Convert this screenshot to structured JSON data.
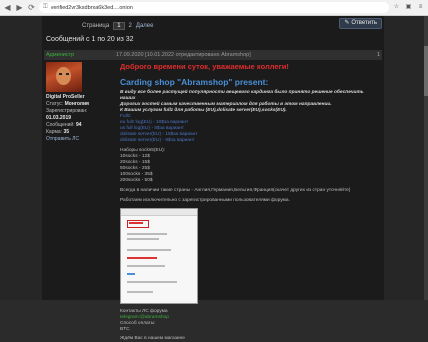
{
  "browser": {
    "url": "verified2vr3ksdbrxa6k3ed....onion",
    "lock_icon": "lock-icon"
  },
  "pager": {
    "label": "Страница",
    "current": "1",
    "next_page": "2",
    "next_label": "Далее"
  },
  "reply_label": "Ответить",
  "message_count": "Сообщений с 1 по 20 из 32",
  "post": {
    "author": "Администр",
    "date": "17.09.2020  [10.01.2022 отредактировано Abramshop]",
    "number": "1"
  },
  "user": {
    "name": "Digital ProSeller",
    "groups": [
      {
        "label": "Статус:",
        "value": "Монголия"
      },
      {
        "label": "Зарегистрирован:",
        "value": ""
      },
      {
        "label": "",
        "value": "01.03.2019"
      },
      {
        "label": "Сообщений:",
        "value": "94"
      },
      {
        "label": "Карма:",
        "value": "35"
      }
    ],
    "pm": "Отправить ЛС"
  },
  "body": {
    "greeting": "Доброго времени суток, уважаемые коллеги!",
    "shop_title": "Carding shop \"Abramshop\" present:",
    "intro_lines": [
      "В виду все более растущей популярности вещевого кардинга было принято решение обеспечить наших",
      "Дорогих гостей самым качественным материалом для работы в этом направлении.",
      "К Вашим услугам fullz для работы (EU),dolisate server(EU),socks(EU)."
    ],
    "links": [
      "Fullz:",
      "eu fulz log(EU) - 10$за вариант",
      "us full log(EU) - 8$за вариант",
      "dolisate server(EU) - 15$за вариант",
      "dolisate server(EU) - 8$за вариант"
    ],
    "socks_header": "Наборы socks5(EU):",
    "socks": [
      "10socks - 12$",
      "20socks - 15$",
      "50socks - 25$",
      "100socks - 35$",
      "200socks - 50$"
    ],
    "countries": "Всегда в наличии такие страны - Англия,Германия,Бельгия,Франция(скачет других из стран уточняйте)",
    "works_note": "Работаем исключительно с зарегистрированными пользователями форума.",
    "contacts": [
      "Контакты ЛС форума",
      "telegram:@abramshop",
      "Способ оплаты:",
      "BTC"
    ],
    "footer": "Ждём Вас в нашем магазине"
  }
}
